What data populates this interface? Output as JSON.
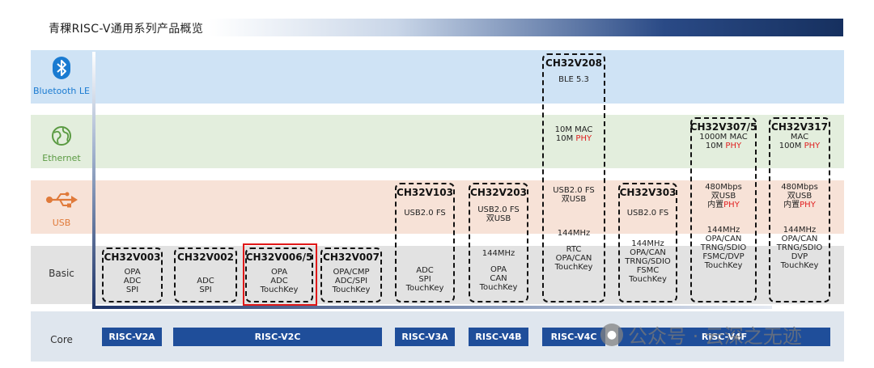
{
  "header": {
    "title": "青稞RISC-V通用系列产品概览"
  },
  "rows": {
    "ble": {
      "label": "Bluetooth LE",
      "icon": "bluetooth-icon",
      "color": "#1a7bd1"
    },
    "eth": {
      "label": "Ethernet",
      "icon": "ethernet-globe-icon",
      "color": "#5a9a42"
    },
    "usb": {
      "label": "USB",
      "icon": "usb-icon",
      "color": "#e07a3a"
    },
    "basic": {
      "label": "Basic"
    },
    "core": {
      "label": "Core"
    }
  },
  "chips": [
    {
      "name": "CH32V003",
      "basic": [
        "OPA",
        "ADC",
        "SPI"
      ]
    },
    {
      "name": "CH32V002",
      "basic": [
        "ADC",
        "SPI"
      ]
    },
    {
      "name": "CH32V006/5",
      "basic": [
        "OPA",
        "ADC",
        "TouchKey"
      ],
      "highlighted": true
    },
    {
      "name": "CH32V007",
      "basic": [
        "OPA/CMP",
        "ADC/SPI",
        "TouchKey"
      ]
    },
    {
      "name": "CH32V103",
      "usb": [
        "USB2.0 FS"
      ],
      "basic": [
        "ADC",
        "SPI",
        "TouchKey"
      ]
    },
    {
      "name": "CH32V203",
      "usb": [
        "USB2.0 FS",
        "双USB"
      ],
      "basic": [
        "144MHz",
        "OPA",
        "CAN",
        "TouchKey"
      ]
    },
    {
      "name": "CH32V208",
      "ble": [
        "BLE 5.3"
      ],
      "eth_mac": "10M MAC",
      "eth_phy_prefix": "10M ",
      "eth_phy_red": "PHY",
      "usb": [
        "USB2.0 FS",
        "双USB"
      ],
      "basic": [
        "144MHz",
        "RTC",
        "OPA/CAN",
        "TouchKey"
      ]
    },
    {
      "name": "CH32V303",
      "usb": [
        "USB2.0 FS"
      ],
      "basic": [
        "144MHz",
        "OPA/CAN",
        "TRNG/SDIO",
        "FSMC",
        "TouchKey"
      ]
    },
    {
      "name": "CH32V307/5",
      "eth_mac": "1000M MAC",
      "eth_phy_prefix": "10M ",
      "eth_phy_red": "PHY",
      "usb": [
        "480Mbps",
        "双USB"
      ],
      "usb_phy_prefix": "内置",
      "usb_phy_red": "PHY",
      "basic": [
        "144MHz",
        "OPA/CAN",
        "TRNG/SDIO",
        "FSMC/DVP",
        "TouchKey"
      ]
    },
    {
      "name": "CH32V317",
      "eth_mac": "MAC",
      "eth_phy_prefix": "100M ",
      "eth_phy_red": "PHY",
      "usb": [
        "480Mbps",
        "双USB"
      ],
      "usb_phy_prefix": "内置",
      "usb_phy_red": "PHY",
      "basic": [
        "144MHz",
        "OPA/CAN",
        "TRNG/SDIO",
        "DVP",
        "TouchKey"
      ]
    }
  ],
  "cores": [
    "RISC-V2A",
    "RISC-V2C",
    "RISC-V3A",
    "RISC-V4B",
    "RISC-V4C",
    "RISC-V4F"
  ],
  "watermark": {
    "text": "公众号 · 云深之无迹",
    "icon": "wechat-icon"
  },
  "colors": {
    "core_bar": "#1f4e9a",
    "phy_red": "#e02020",
    "highlight": "#e01818"
  }
}
